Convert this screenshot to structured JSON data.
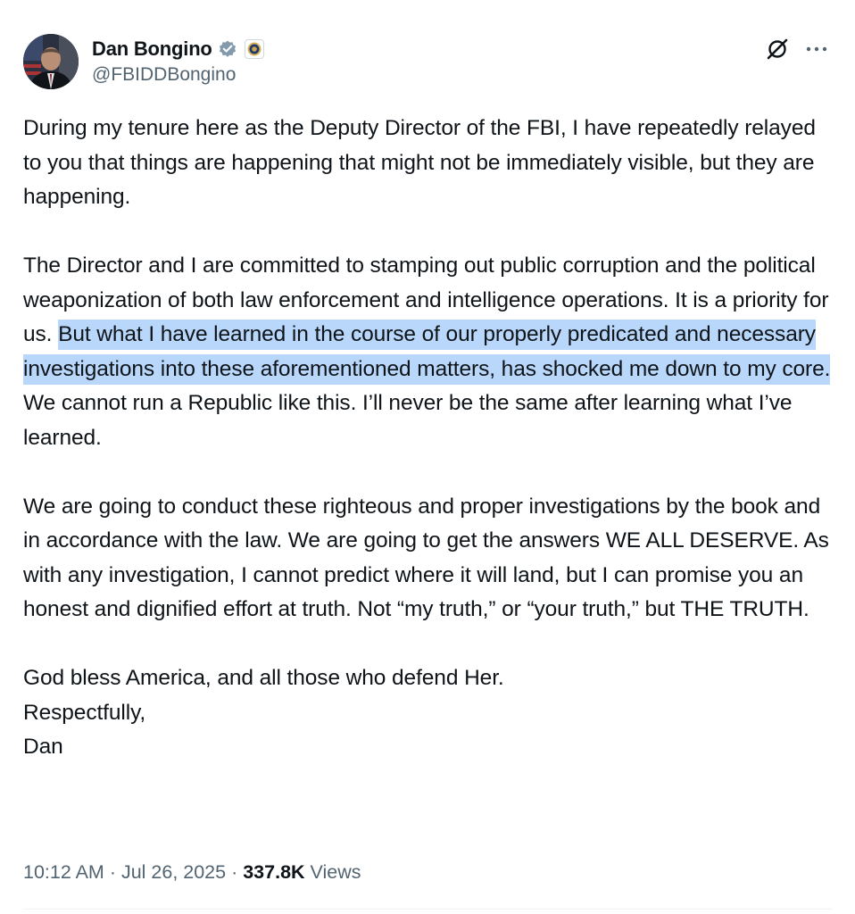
{
  "author": {
    "display_name": "Dan Bongino",
    "handle": "@FBIDDBongino",
    "verified_color": "#829aab"
  },
  "post": {
    "p1": "During my tenure here as the Deputy Director of the FBI, I have repeatedly relayed to you that things are happening that might not be immediately visible, but they are happening.",
    "p2_before": "The Director and I are committed to stamping out public corruption and the political weaponization of both law enforcement and intelligence operations. It is a priority for us. ",
    "p2_highlight": "But what I have learned in the course of our properly predicated and necessary investigations into these aforementioned matters, has shocked me down to my core.",
    "p2_after": " We cannot run a Republic like this. I’ll never be the same after learning what I’ve learned.",
    "p3": "We are going to conduct these righteous and proper investigations by the book and in accordance with the law. We are going to get the answers WE ALL DESERVE. As with any investigation, I cannot predict where it will land, but I can promise you an honest and dignified effort at truth. Not “my truth,” or “your truth,” but THE TRUTH.",
    "p4_line1": "God bless America, and all those who defend Her.",
    "p4_line2": "Respectfully,",
    "p4_line3": "Dan",
    "highlight_color": "#b9d7fb"
  },
  "meta": {
    "time": "10:12 AM",
    "separator": " · ",
    "date": "Jul 26, 2025",
    "views_count": "337.8K",
    "views_label": " Views"
  },
  "icons": {
    "verified": "verified-badge-icon",
    "affiliate": "fbi-seal-icon",
    "grok": "grok-icon",
    "more": "more-icon"
  }
}
